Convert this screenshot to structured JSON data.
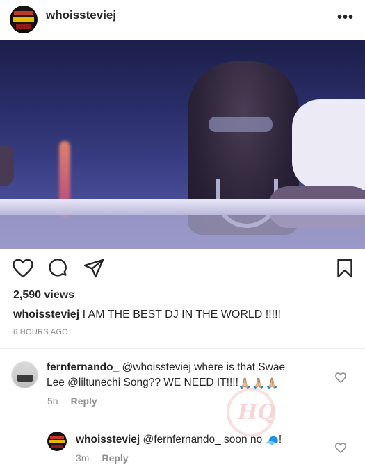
{
  "post": {
    "author": "whoissteviej",
    "more_icon": "•••",
    "views": "2,590 views",
    "caption_user": "whoissteviej",
    "caption_text": "I AM THE BEST DJ IN THE WORLD !!!!!",
    "timestamp": "6 HOURS AGO"
  },
  "actions": {
    "icons": [
      "heart-icon",
      "comment-icon",
      "share-icon",
      "bookmark-icon"
    ]
  },
  "comments": [
    {
      "user": "fernfernando_",
      "text_line1": "@whoissteviej where is that Swae",
      "text_line2": "Lee @liltunechi Song?? WE NEED IT!!!!",
      "emoji": "🙏🏼🙏🏼🙏🏼",
      "time": "5h",
      "reply": "Reply"
    },
    {
      "user": "whoissteviej",
      "text": "@fernfernando_ soon no",
      "emoji": "🧢",
      "text_end": "!",
      "time": "3m",
      "reply": "Reply"
    }
  ],
  "watermark": "HQ",
  "colors": {
    "text": "#262626",
    "muted": "#8e8e8e",
    "divider": "#efefef"
  }
}
